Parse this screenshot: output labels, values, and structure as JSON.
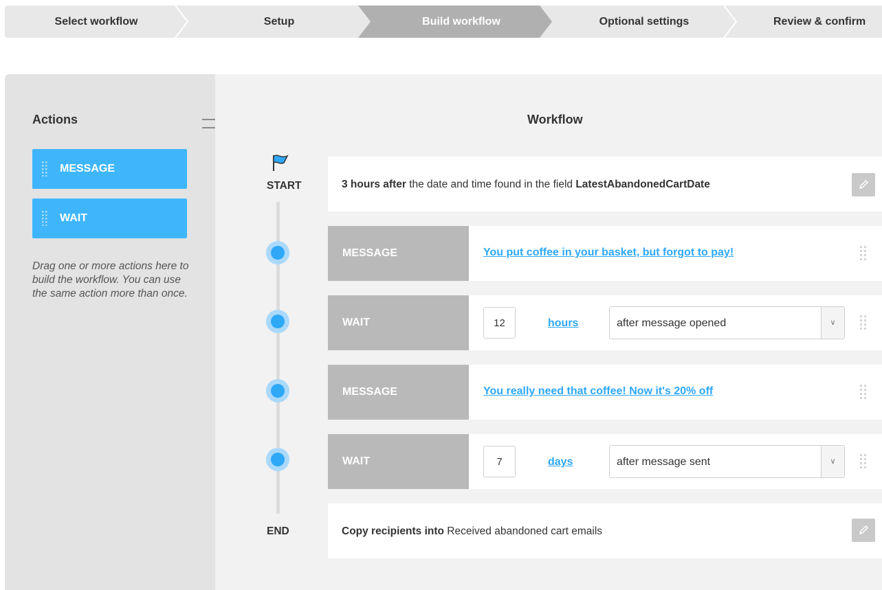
{
  "steps": [
    {
      "label": "Select workflow",
      "active": false
    },
    {
      "label": "Setup",
      "active": false
    },
    {
      "label": "Build workflow",
      "active": true
    },
    {
      "label": "Optional settings",
      "active": false
    },
    {
      "label": "Review & confirm",
      "active": false
    }
  ],
  "actions_panel": {
    "title": "Actions",
    "buttons": [
      {
        "label": "MESSAGE",
        "icon": "drag-handle-icon"
      },
      {
        "label": "WAIT",
        "icon": "drag-handle-icon"
      }
    ],
    "hint": "Drag one or more actions here to build the workflow. You can use the same action more than once.",
    "collapse_icon": "double-arrow-right-icon"
  },
  "workflow": {
    "title": "Workflow",
    "start_label": "START",
    "end_label": "END",
    "start_icon": "flag-icon",
    "trigger": {
      "bold": "3 hours after",
      "middle": " the date and time found in the field ",
      "field": "LatestAbandonedCartDate",
      "edit_icon": "pencil-icon"
    },
    "steps": [
      {
        "type": "MESSAGE",
        "link": "You put coffee in your basket, but forgot to pay!"
      },
      {
        "type": "WAIT",
        "amount": "12",
        "unit": "hours",
        "condition": "after message opened"
      },
      {
        "type": "MESSAGE",
        "link": "You really need that coffee! Now it's 20% off"
      },
      {
        "type": "WAIT",
        "amount": "7",
        "unit": "days",
        "condition": "after message sent"
      }
    ],
    "end_action": {
      "bold": "Copy recipients into",
      "rest": " Received abandoned cart emails",
      "edit_icon": "pencil-icon"
    }
  },
  "colors": {
    "accent": "#3fb6fb",
    "link": "#2ea8f7",
    "step_active": "#b0b0b0",
    "row_type_bg": "#b9b9b9"
  }
}
